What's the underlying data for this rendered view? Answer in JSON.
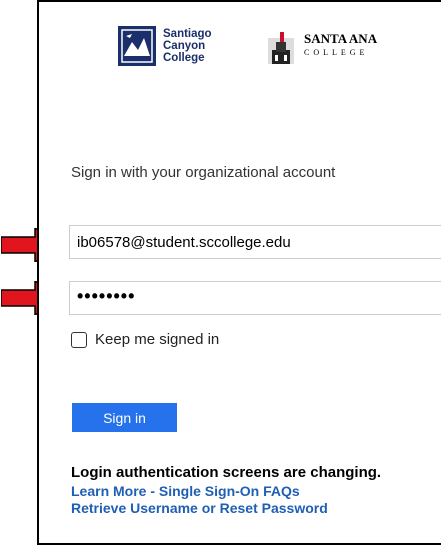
{
  "logos": {
    "scc": [
      "Santiago",
      "Canyon",
      "College"
    ],
    "sac_line1": "SANTA ANA",
    "sac_line2": "COLLEGE"
  },
  "heading": "Sign in with your organizational account",
  "email": {
    "value": "ib06578@student.sccollege.edu"
  },
  "password": {
    "masked_value": "••••••••"
  },
  "keep_signed_in": {
    "label": "Keep me signed in",
    "checked": false
  },
  "sign_in_button": "Sign in",
  "notice": "Login authentication screens are changing.",
  "links": {
    "faq": "Learn More - Single Sign-On FAQs",
    "reset": "Retrieve Username or Reset Password"
  },
  "colors": {
    "accent": "#2672ec",
    "link": "#1f5fb4",
    "arrow": "#e0151d",
    "scc_brand": "#1b2f6b"
  },
  "icons": [
    "red-arrow-icon",
    "scc-logo-icon",
    "sac-logo-icon"
  ]
}
